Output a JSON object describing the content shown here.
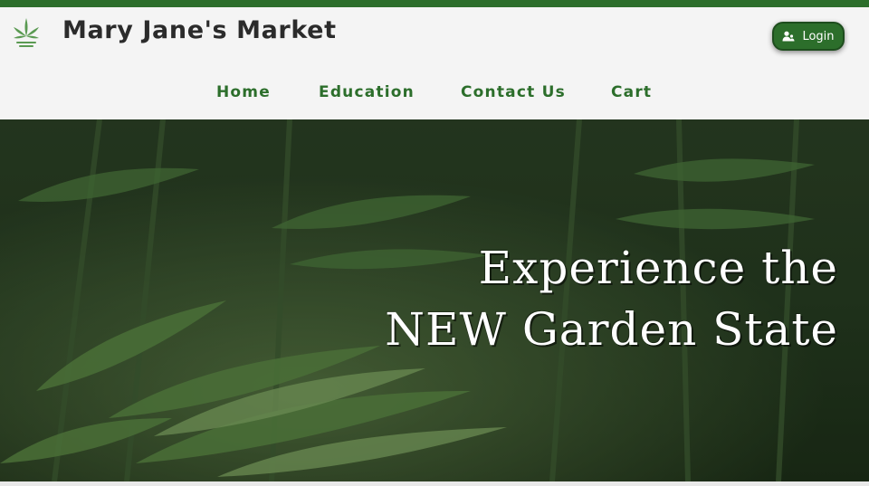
{
  "header": {
    "brand": "Mary Jane's Market",
    "logo_icon": "cannabis-leaf-logo",
    "login_label": "Login",
    "login_icon": "user-group-icon"
  },
  "nav": {
    "items": [
      {
        "label": "Home"
      },
      {
        "label": "Education"
      },
      {
        "label": "Contact Us"
      },
      {
        "label": "Cart"
      }
    ]
  },
  "hero": {
    "line1": "Experience the",
    "line2": "NEW Garden State"
  },
  "colors": {
    "accent": "#2c6e2b",
    "background": "#f4f4f4",
    "text": "#2b2b2b"
  }
}
